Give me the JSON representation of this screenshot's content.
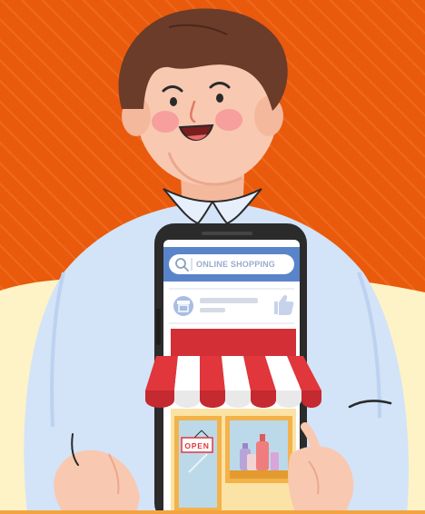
{
  "colors": {
    "background_orange": "#e95a0c",
    "background_cream": "#fdf3c7",
    "shirt": "#d3e3f8",
    "hair": "#6b3c2a",
    "skin": "#f9c8b0",
    "phone_body": "#2b2b2b",
    "search_bar": "#5a84c9",
    "awning_red": "#e0363c",
    "store_wall": "#fbe3a5",
    "window_glass": "#bcd9ea"
  },
  "phone": {
    "search_placeholder": "ONLINE SHOPPING",
    "search_icon": "magnifier-icon",
    "store_icon": "storefront-icon",
    "like_icon": "thumbs-up-icon"
  },
  "store": {
    "door_sign": "OPEN"
  }
}
